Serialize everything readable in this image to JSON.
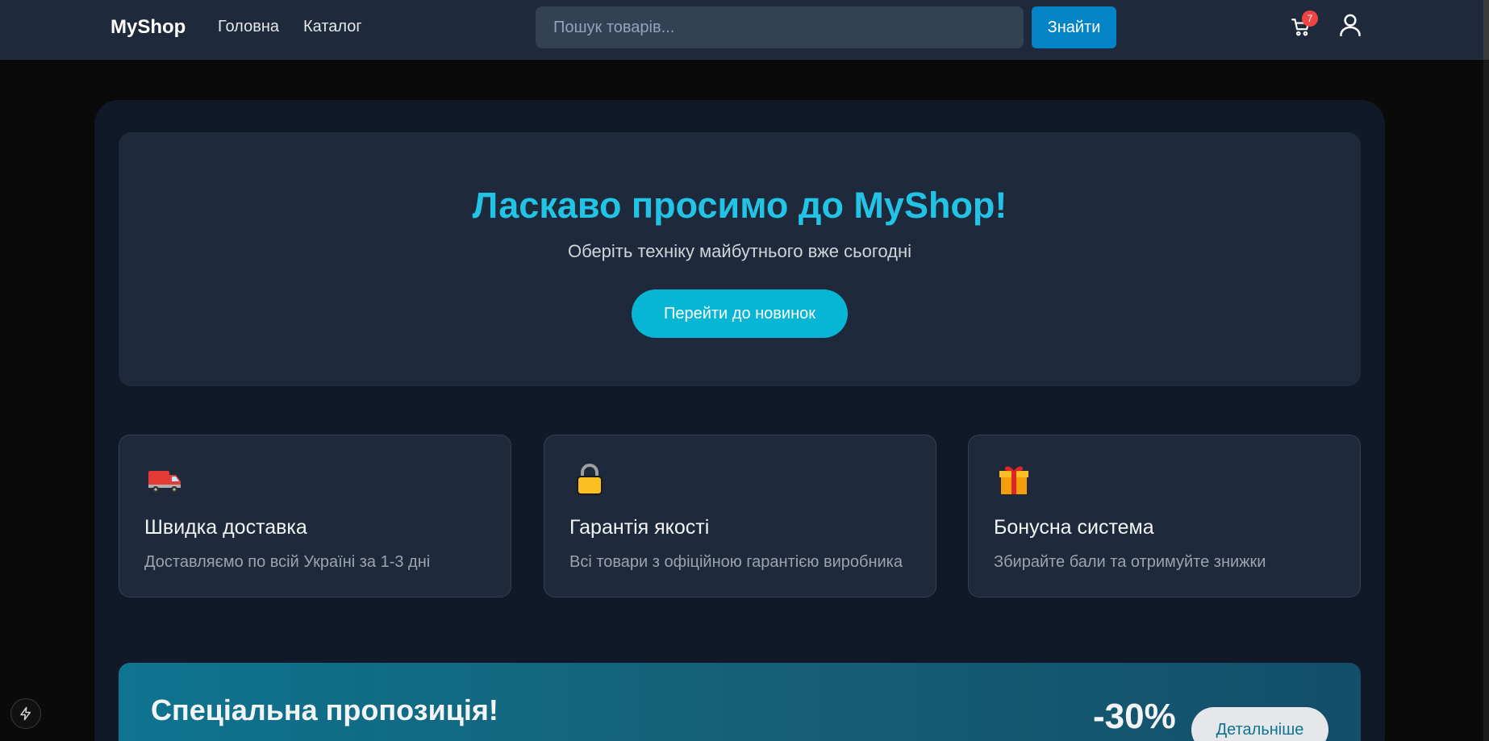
{
  "header": {
    "logo": "MyShop",
    "nav": [
      "Головна",
      "Каталог"
    ],
    "search_placeholder": "Пошук товарів...",
    "search_button": "Знайти",
    "cart_count": "7",
    "cart_icon": "cart-icon",
    "user_icon": "user-icon"
  },
  "hero": {
    "title": "Ласкаво просимо до MyShop!",
    "subtitle": "Оберіть техніку майбутнього вже сьогодні",
    "button": "Перейти до новинок"
  },
  "features": [
    {
      "icon": "delivery-truck-icon",
      "title": "Швидка доставка",
      "desc": "Доставляємо по всій Україні за 1-3 дні"
    },
    {
      "icon": "lock-icon",
      "title": "Гарантія якості",
      "desc": "Всі товари з офіційною гарантією виробника"
    },
    {
      "icon": "gift-icon",
      "title": "Бонусна система",
      "desc": "Збирайте бали та отримуйте знижки"
    }
  ],
  "promo": {
    "title": "Спеціальна пропозиція!",
    "discount": "-30%",
    "button": "Детальніше"
  },
  "colors": {
    "accent": "#22c4e6",
    "header_bg": "#1e293b",
    "search_button": "#0284c7",
    "badge": "#ef4444"
  }
}
